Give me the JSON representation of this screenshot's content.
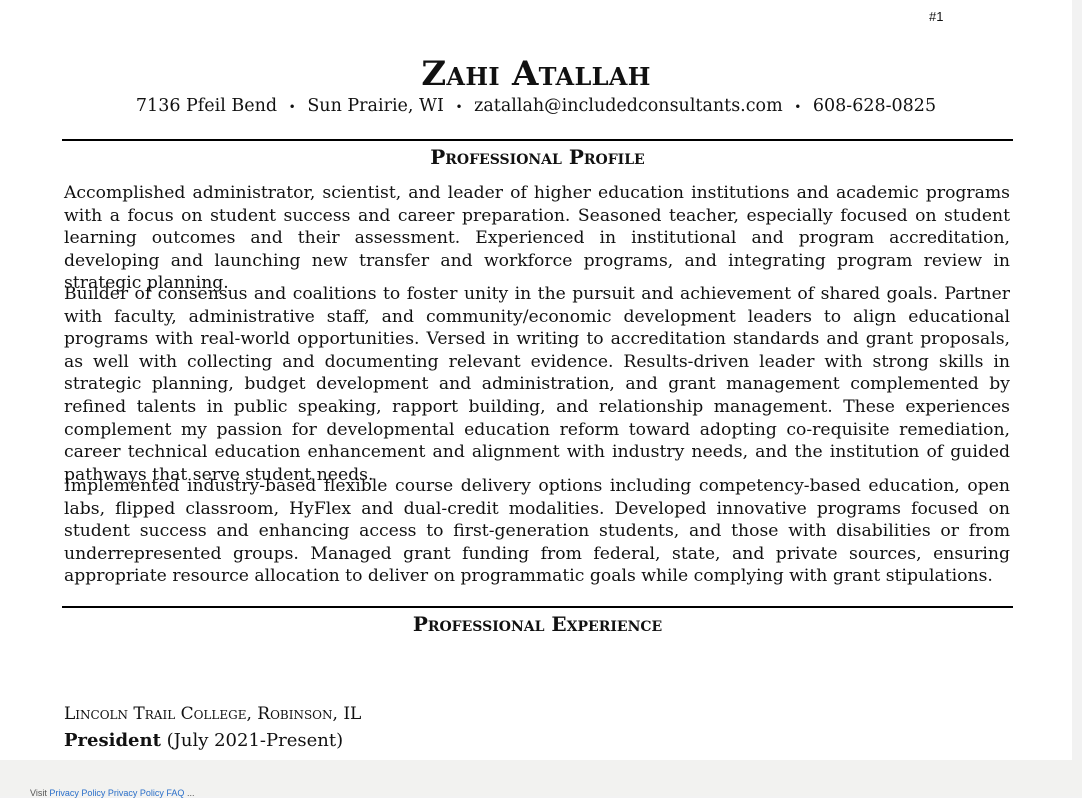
{
  "page_number": "#1",
  "header": {
    "name": "Zahi Atallah",
    "contact": {
      "address": "7136 Pfeil Bend",
      "city": "Sun Prairie, WI",
      "email": "zatallah@includedconsultants.com",
      "phone": "608-628-0825",
      "separator": "•"
    }
  },
  "profile": {
    "title": "Professional Profile",
    "paragraphs": [
      "Accomplished administrator, scientist, and leader of higher education institutions and academic programs with a focus on student success and career preparation. Seasoned teacher, especially focused on student learning outcomes and their assessment. Experienced in institutional and program accreditation, developing and launching new transfer and workforce programs, and integrating program review in strategic planning.",
      "Builder of consensus and coalitions to foster unity in the pursuit and achievement of shared goals. Partner with faculty, administrative staff, and community/economic development leaders to align educational programs with real-world opportunities. Versed in writing to accreditation standards and grant proposals, as well with collecting and documenting relevant evidence. Results-driven leader with strong skills in strategic planning, budget development and administration, and grant management complemented by refined talents in public speaking, rapport building, and relationship management. These experiences complement my passion for developmental education reform toward adopting co-requisite remediation, career technical education enhancement and alignment with industry needs, and the institution of guided pathways that serve student needs.",
      "Implemented industry-based flexible course delivery options including competency-based education, open labs, flipped classroom, HyFlex and dual-credit modalities. Developed innovative programs focused on student success and enhancing access to first-generation students, and those with disabilities or from underrepresented groups. Managed grant funding from federal, state, and private sources, ensuring appropriate resource allocation to deliver on programmatic goals while complying with grant stipulations."
    ]
  },
  "experience": {
    "title": "Professional Experience",
    "employer": "Lincoln Trail College, Robinson, IL",
    "position": "President",
    "dates": "(July 2021-Present)"
  },
  "footer": {
    "prefix": "Visit",
    "link1": "Privacy Policy",
    "link2": "Privacy Policy FAQ",
    "suffix": "..."
  }
}
